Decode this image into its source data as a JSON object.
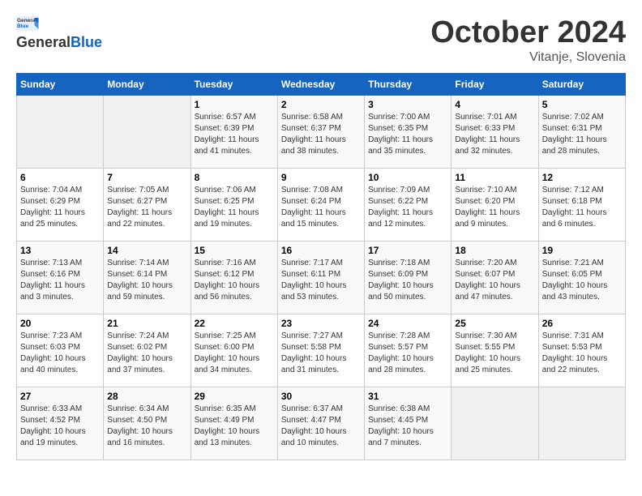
{
  "header": {
    "logo_line1": "General",
    "logo_line2": "Blue",
    "month": "October 2024",
    "location": "Vitanje, Slovenia"
  },
  "weekdays": [
    "Sunday",
    "Monday",
    "Tuesday",
    "Wednesday",
    "Thursday",
    "Friday",
    "Saturday"
  ],
  "weeks": [
    [
      {
        "day": "",
        "sunrise": "",
        "sunset": "",
        "daylight": ""
      },
      {
        "day": "",
        "sunrise": "",
        "sunset": "",
        "daylight": ""
      },
      {
        "day": "1",
        "sunrise": "Sunrise: 6:57 AM",
        "sunset": "Sunset: 6:39 PM",
        "daylight": "Daylight: 11 hours and 41 minutes."
      },
      {
        "day": "2",
        "sunrise": "Sunrise: 6:58 AM",
        "sunset": "Sunset: 6:37 PM",
        "daylight": "Daylight: 11 hours and 38 minutes."
      },
      {
        "day": "3",
        "sunrise": "Sunrise: 7:00 AM",
        "sunset": "Sunset: 6:35 PM",
        "daylight": "Daylight: 11 hours and 35 minutes."
      },
      {
        "day": "4",
        "sunrise": "Sunrise: 7:01 AM",
        "sunset": "Sunset: 6:33 PM",
        "daylight": "Daylight: 11 hours and 32 minutes."
      },
      {
        "day": "5",
        "sunrise": "Sunrise: 7:02 AM",
        "sunset": "Sunset: 6:31 PM",
        "daylight": "Daylight: 11 hours and 28 minutes."
      }
    ],
    [
      {
        "day": "6",
        "sunrise": "Sunrise: 7:04 AM",
        "sunset": "Sunset: 6:29 PM",
        "daylight": "Daylight: 11 hours and 25 minutes."
      },
      {
        "day": "7",
        "sunrise": "Sunrise: 7:05 AM",
        "sunset": "Sunset: 6:27 PM",
        "daylight": "Daylight: 11 hours and 22 minutes."
      },
      {
        "day": "8",
        "sunrise": "Sunrise: 7:06 AM",
        "sunset": "Sunset: 6:25 PM",
        "daylight": "Daylight: 11 hours and 19 minutes."
      },
      {
        "day": "9",
        "sunrise": "Sunrise: 7:08 AM",
        "sunset": "Sunset: 6:24 PM",
        "daylight": "Daylight: 11 hours and 15 minutes."
      },
      {
        "day": "10",
        "sunrise": "Sunrise: 7:09 AM",
        "sunset": "Sunset: 6:22 PM",
        "daylight": "Daylight: 11 hours and 12 minutes."
      },
      {
        "day": "11",
        "sunrise": "Sunrise: 7:10 AM",
        "sunset": "Sunset: 6:20 PM",
        "daylight": "Daylight: 11 hours and 9 minutes."
      },
      {
        "day": "12",
        "sunrise": "Sunrise: 7:12 AM",
        "sunset": "Sunset: 6:18 PM",
        "daylight": "Daylight: 11 hours and 6 minutes."
      }
    ],
    [
      {
        "day": "13",
        "sunrise": "Sunrise: 7:13 AM",
        "sunset": "Sunset: 6:16 PM",
        "daylight": "Daylight: 11 hours and 3 minutes."
      },
      {
        "day": "14",
        "sunrise": "Sunrise: 7:14 AM",
        "sunset": "Sunset: 6:14 PM",
        "daylight": "Daylight: 10 hours and 59 minutes."
      },
      {
        "day": "15",
        "sunrise": "Sunrise: 7:16 AM",
        "sunset": "Sunset: 6:12 PM",
        "daylight": "Daylight: 10 hours and 56 minutes."
      },
      {
        "day": "16",
        "sunrise": "Sunrise: 7:17 AM",
        "sunset": "Sunset: 6:11 PM",
        "daylight": "Daylight: 10 hours and 53 minutes."
      },
      {
        "day": "17",
        "sunrise": "Sunrise: 7:18 AM",
        "sunset": "Sunset: 6:09 PM",
        "daylight": "Daylight: 10 hours and 50 minutes."
      },
      {
        "day": "18",
        "sunrise": "Sunrise: 7:20 AM",
        "sunset": "Sunset: 6:07 PM",
        "daylight": "Daylight: 10 hours and 47 minutes."
      },
      {
        "day": "19",
        "sunrise": "Sunrise: 7:21 AM",
        "sunset": "Sunset: 6:05 PM",
        "daylight": "Daylight: 10 hours and 43 minutes."
      }
    ],
    [
      {
        "day": "20",
        "sunrise": "Sunrise: 7:23 AM",
        "sunset": "Sunset: 6:03 PM",
        "daylight": "Daylight: 10 hours and 40 minutes."
      },
      {
        "day": "21",
        "sunrise": "Sunrise: 7:24 AM",
        "sunset": "Sunset: 6:02 PM",
        "daylight": "Daylight: 10 hours and 37 minutes."
      },
      {
        "day": "22",
        "sunrise": "Sunrise: 7:25 AM",
        "sunset": "Sunset: 6:00 PM",
        "daylight": "Daylight: 10 hours and 34 minutes."
      },
      {
        "day": "23",
        "sunrise": "Sunrise: 7:27 AM",
        "sunset": "Sunset: 5:58 PM",
        "daylight": "Daylight: 10 hours and 31 minutes."
      },
      {
        "day": "24",
        "sunrise": "Sunrise: 7:28 AM",
        "sunset": "Sunset: 5:57 PM",
        "daylight": "Daylight: 10 hours and 28 minutes."
      },
      {
        "day": "25",
        "sunrise": "Sunrise: 7:30 AM",
        "sunset": "Sunset: 5:55 PM",
        "daylight": "Daylight: 10 hours and 25 minutes."
      },
      {
        "day": "26",
        "sunrise": "Sunrise: 7:31 AM",
        "sunset": "Sunset: 5:53 PM",
        "daylight": "Daylight: 10 hours and 22 minutes."
      }
    ],
    [
      {
        "day": "27",
        "sunrise": "Sunrise: 6:33 AM",
        "sunset": "Sunset: 4:52 PM",
        "daylight": "Daylight: 10 hours and 19 minutes."
      },
      {
        "day": "28",
        "sunrise": "Sunrise: 6:34 AM",
        "sunset": "Sunset: 4:50 PM",
        "daylight": "Daylight: 10 hours and 16 minutes."
      },
      {
        "day": "29",
        "sunrise": "Sunrise: 6:35 AM",
        "sunset": "Sunset: 4:49 PM",
        "daylight": "Daylight: 10 hours and 13 minutes."
      },
      {
        "day": "30",
        "sunrise": "Sunrise: 6:37 AM",
        "sunset": "Sunset: 4:47 PM",
        "daylight": "Daylight: 10 hours and 10 minutes."
      },
      {
        "day": "31",
        "sunrise": "Sunrise: 6:38 AM",
        "sunset": "Sunset: 4:45 PM",
        "daylight": "Daylight: 10 hours and 7 minutes."
      },
      {
        "day": "",
        "sunrise": "",
        "sunset": "",
        "daylight": ""
      },
      {
        "day": "",
        "sunrise": "",
        "sunset": "",
        "daylight": ""
      }
    ]
  ]
}
